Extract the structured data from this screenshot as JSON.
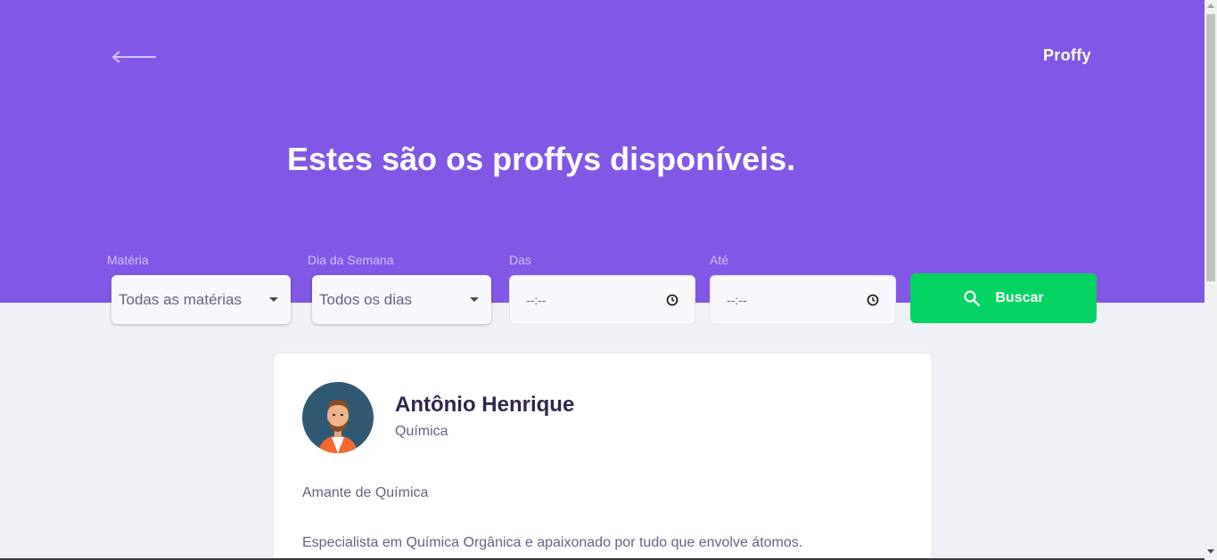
{
  "header": {
    "logo": "Proffy",
    "title": "Estes são os proffys disponíveis."
  },
  "filters": {
    "subject": {
      "label": "Matéria",
      "value": "Todas as matérias"
    },
    "weekday": {
      "label": "Dia da Semana",
      "value": "Todos os dias"
    },
    "from": {
      "label": "Das",
      "value": "--:--"
    },
    "to": {
      "label": "Até",
      "value": "--:--"
    },
    "search_label": "Buscar"
  },
  "teacher": {
    "name": "Antônio Henrique",
    "subject": "Química",
    "bio_line1": "Amante de Química",
    "bio_line2": "Especialista em Química Orgânica e apaixonado por tudo que envolve átomos."
  },
  "colors": {
    "primary": "#8257e5",
    "secondary": "#04d361",
    "background": "#f0f0f7"
  }
}
